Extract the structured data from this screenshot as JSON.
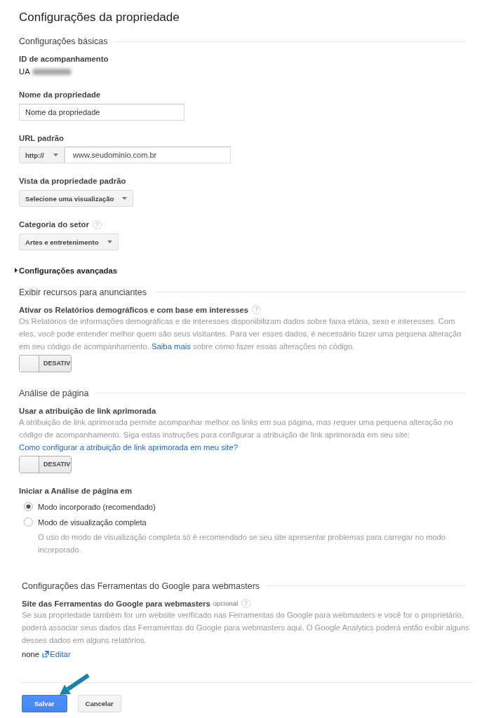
{
  "page": {
    "title": "Configurações da propriedade"
  },
  "sections": [
    {
      "title": "Configurações básicas",
      "items": [
        {
          "kind": "readonly",
          "label": "ID de acompanhamento",
          "value": "UA",
          "redacted": true
        },
        {
          "kind": "text_input",
          "label": "Nome da propriedade",
          "value": "Nome da propriedade"
        },
        {
          "kind": "url_input",
          "label": "URL padrão",
          "protocol": "http://",
          "value": "www.seudominio.com.br"
        },
        {
          "kind": "dropdown",
          "label": "Vista da propriedade padrão",
          "value": "Selecione uma visualização"
        },
        {
          "kind": "dropdown",
          "label": "Categoria do setor",
          "help": "?",
          "value": "Artes e entretenimento"
        },
        {
          "kind": "expander",
          "label": "Configurações avançadas",
          "expanded": false
        }
      ]
    },
    {
      "title": "Exibir recursos para anunciantes",
      "items": [
        {
          "kind": "toggle_setting",
          "label": "Ativar os Relatórios demográficos e com base em interesses",
          "help": "?",
          "description": "Os Relatórios de informações demográficas e de interesses disponibilizam dados sobre faixa etária, sexo e interesses. Com eles, você pode entender melhor quem são seus visitantes. Para ver esses dados, é necessário fazer uma pequena alteração em seu código de acompanhamento. ",
          "link": "Saiba mais",
          "description_end": " sobre como fazer essas alterações no código.",
          "toggle": {
            "label": "DESATIV",
            "on": false
          }
        }
      ]
    },
    {
      "title": "Análise de página",
      "items": [
        {
          "kind": "toggle_setting",
          "label": "Usar a atribuição de link aprimorada",
          "description": "A atribuição de link aprimorada permite acompanhar melhor os links em sua página, mas requer uma pequena alteração no código de acompanhamento. Siga estas instruções para configurar a atribuição de link aprimorada em seu site: ",
          "link": "Como configurar a atribuição de link aprimorada em meu site?",
          "toggle": {
            "label": "DESATIV",
            "on": false
          }
        },
        {
          "kind": "radio_group",
          "label": "Iniciar a Análise de página em",
          "options": [
            {
              "label": "Modo incorporado (recomendado)",
              "selected": true
            },
            {
              "label": "Modo de visualização completa",
              "selected": false,
              "hint": "O uso do modo de visualização completa só é recomendado se seu site apresentar problemas para carregar no modo incorporado."
            }
          ]
        }
      ]
    },
    {
      "title": "Configurações das Ferramentas do Google para webmasters",
      "items": [
        {
          "kind": "link_setting",
          "label": "Site das Ferramentas do Google para webmasters",
          "note": "opcional",
          "help": "?",
          "description": "Se sua propriedade também for um website verificado nas Ferramentas do Google para webmasters e você for o proprietário, poderá associar seus dados das Ferramentas do Google para webmasters aqui. O Google Analytics poderá então exibir alguns desses dados em alguns relatórios.",
          "value": "none",
          "action": "Editar"
        }
      ]
    }
  ],
  "buttons": [
    {
      "label": "Salvar",
      "kind": "primary",
      "arrow_pointer": true
    },
    {
      "label": "Cancelar",
      "kind": "secondary",
      "arrow_pointer": false
    }
  ]
}
